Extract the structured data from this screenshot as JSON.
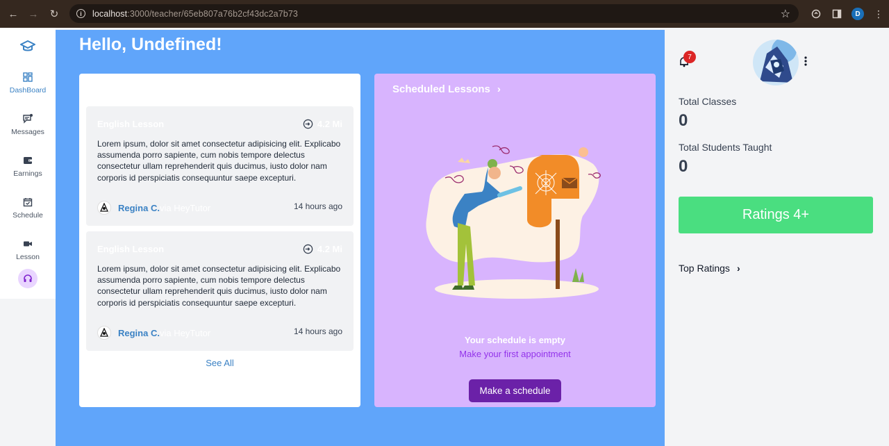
{
  "browser": {
    "url_host": "localhost",
    "url_path": ":3000/teacher/65eb807a76b2cf43dc2a7b73",
    "profile_initial": "D"
  },
  "sidebar": {
    "items": [
      {
        "label": "DashBoard",
        "icon": "dashboard-icon"
      },
      {
        "label": "Messages",
        "icon": "messages-icon"
      },
      {
        "label": "Earnings",
        "icon": "wallet-icon"
      },
      {
        "label": "Schedule",
        "icon": "calendar-icon"
      },
      {
        "label": "Lesson",
        "icon": "video-icon"
      }
    ]
  },
  "main": {
    "greeting": "Hello, Undefined!",
    "lessons": [
      {
        "title": "English Lesson",
        "distance": "4.2 Mi",
        "text": "Lorem ipsum, dolor sit amet consectetur adipisicing elit. Explicabo assumenda porro sapiente, cum nobis tempore delectus consectetur ullam reprehenderit quis ducimus, iusto dolor nam corporis id perspiciatis consequuntur saepe excepturi.",
        "author": "Regina C.",
        "via": "via HeyTutor",
        "ago": "14 hours ago"
      },
      {
        "title": "English Lesson",
        "distance": "4.2 Mi",
        "text": "Lorem ipsum, dolor sit amet consectetur adipisicing elit. Explicabo assumenda porro sapiente, cum nobis tempore delectus consectetur ullam reprehenderit quis ducimus, iusto dolor nam corporis id perspiciatis consequuntur saepe excepturi.",
        "author": "Regina C.",
        "via": "via HeyTutor",
        "ago": "14 hours ago"
      }
    ],
    "see_all": "See All",
    "schedule": {
      "title": "Scheduled Lessons",
      "empty_title": "Your schedule is empty",
      "empty_subtitle": "Make your first appointment",
      "button": "Make a schedule"
    }
  },
  "right": {
    "notifications": "7",
    "total_classes_label": "Total Classes",
    "total_classes_value": "0",
    "total_students_label": "Total Students Taught",
    "total_students_value": "0",
    "ratings_button": "Ratings 4+",
    "top_ratings": "Top Ratings"
  },
  "colors": {
    "main_bg": "#60a5fa",
    "purple_card": "#d8b4fe",
    "button_purple": "#6b21a8",
    "ratings_green": "#4ade80"
  }
}
